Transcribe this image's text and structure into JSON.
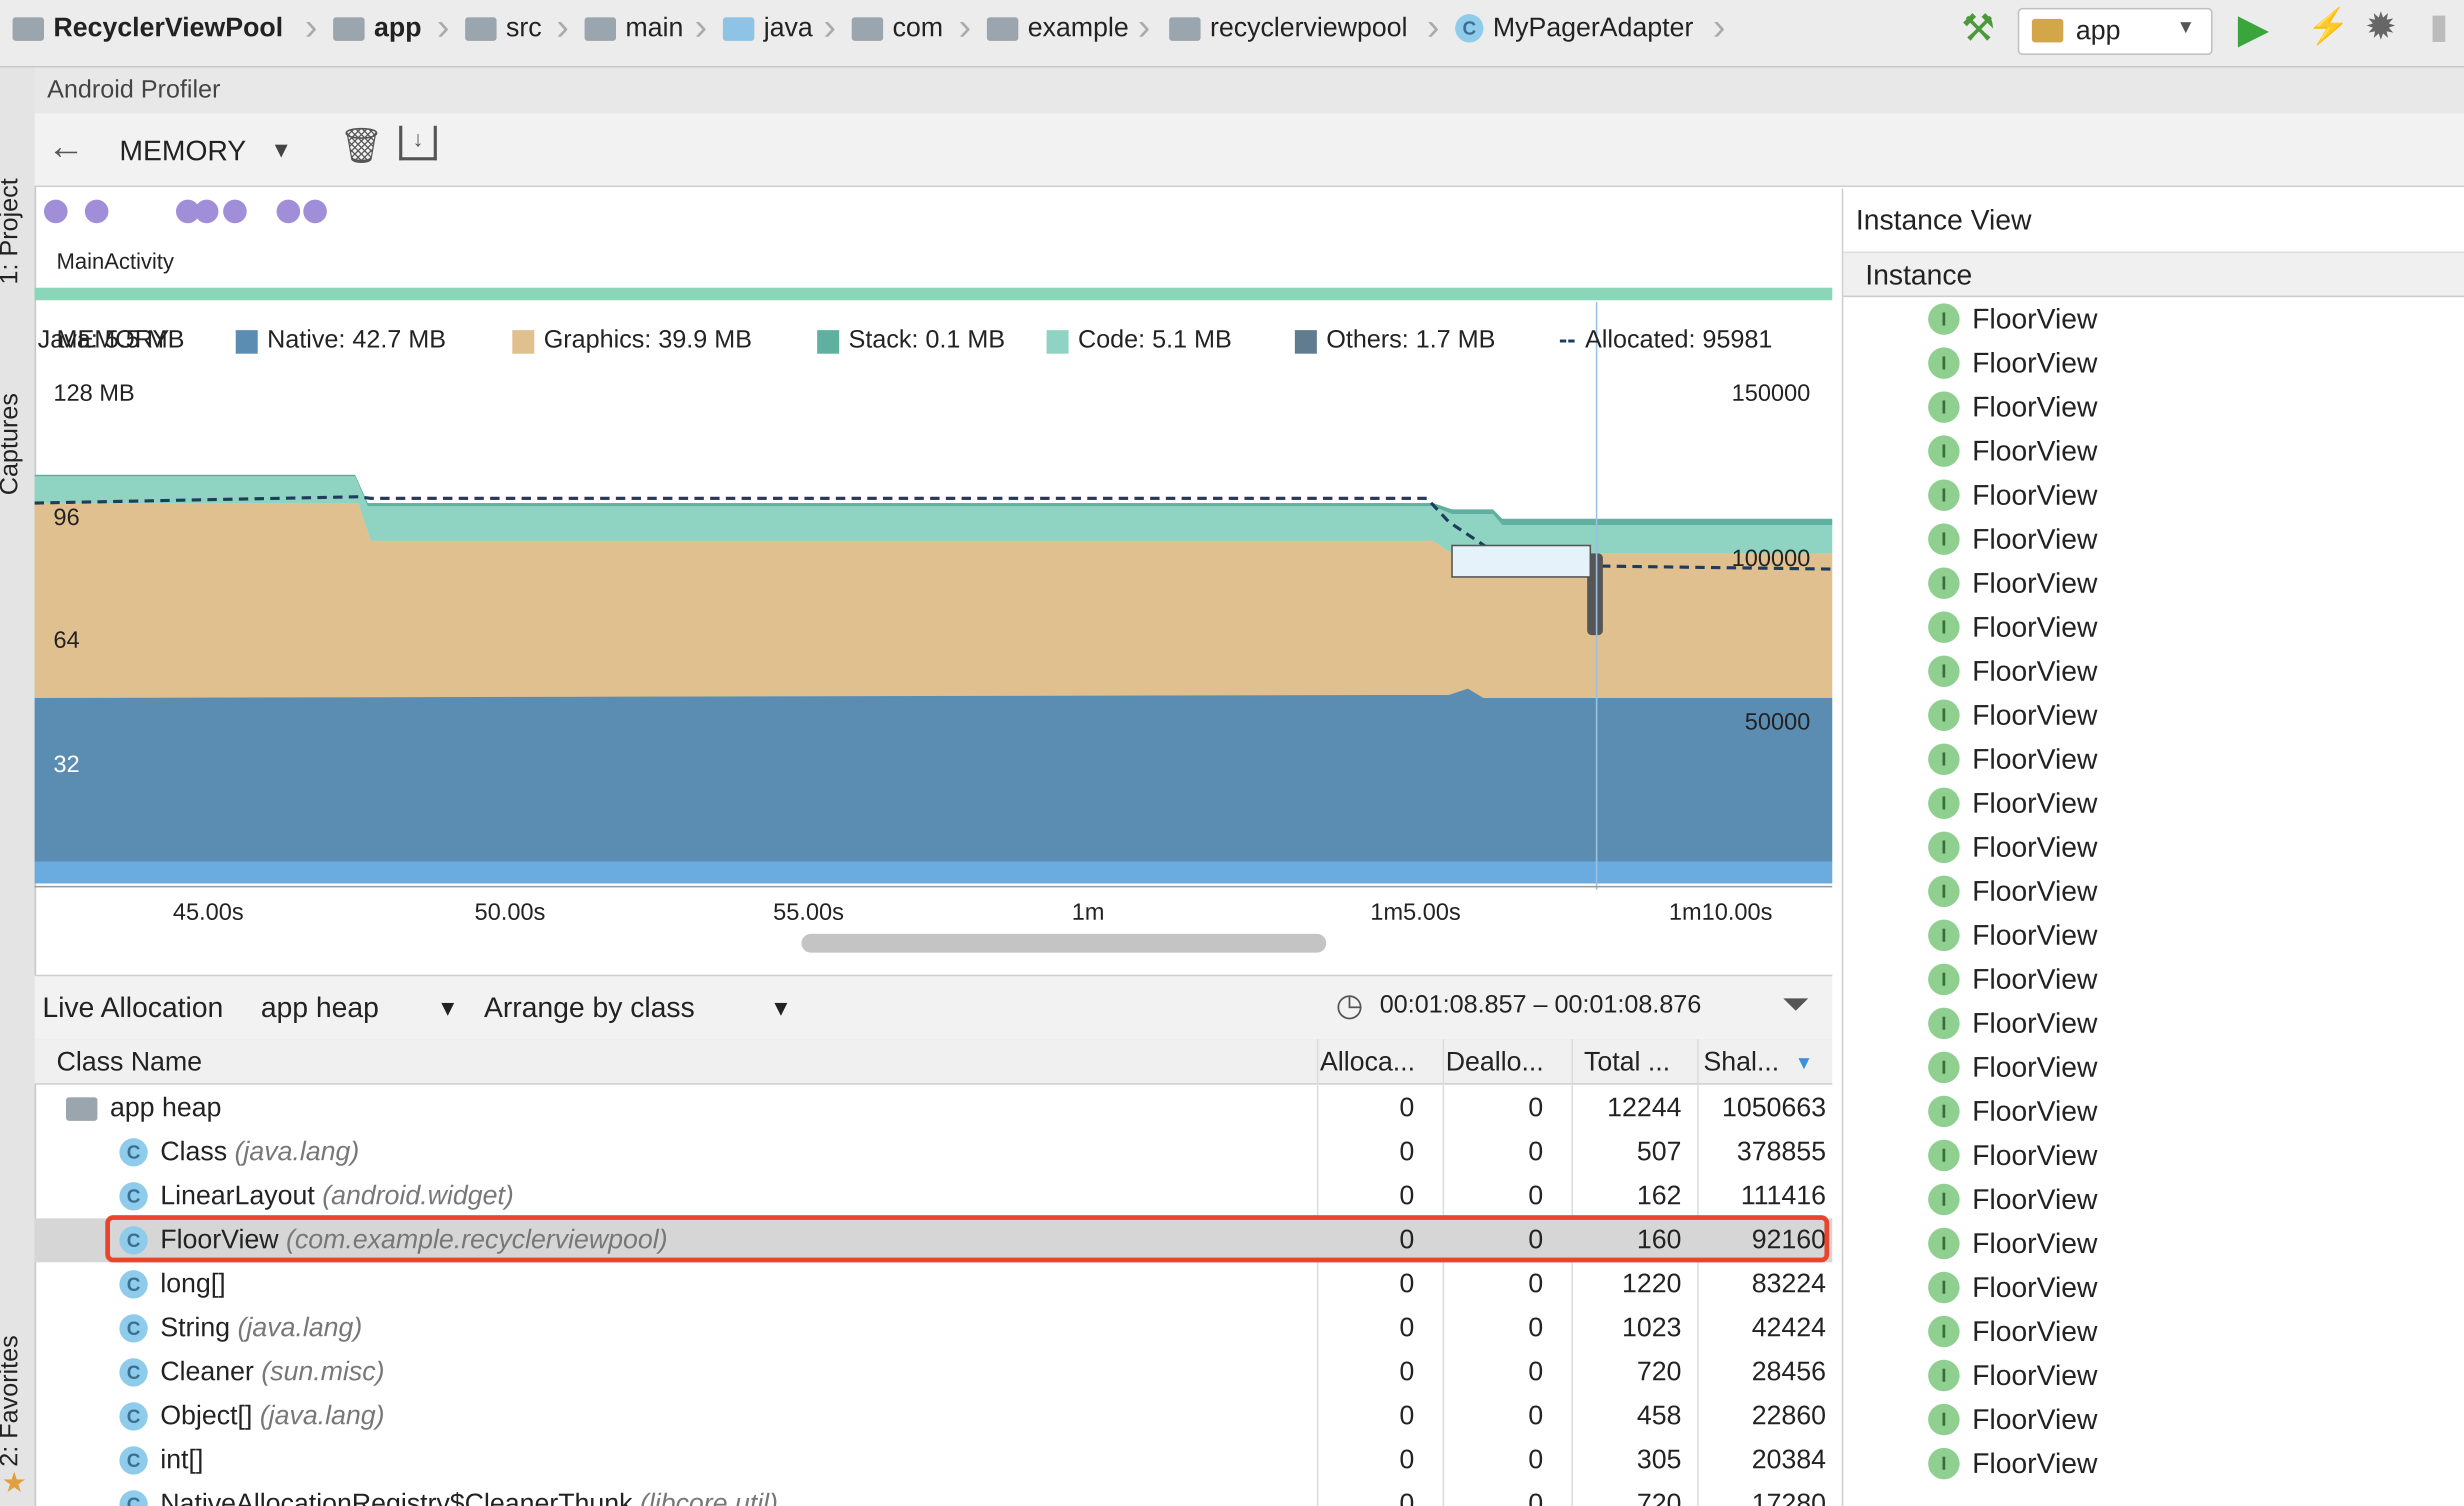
{
  "breadcrumbs": [
    "RecyclerViewPool",
    "app",
    "src",
    "main",
    "java",
    "com",
    "example",
    "recyclerviewpool",
    "MyPagerAdapter"
  ],
  "run_config": "app",
  "side_tabs": {
    "project": "1: Project",
    "captures": "Captures",
    "favorites": "2: Favorites"
  },
  "profiler_title": "Android Profiler",
  "toolbar": {
    "profiler_select": "MEMORY"
  },
  "events": {
    "activity_label": "MainActivity"
  },
  "memory_chart": {
    "overlay_label": "MEMORY",
    "legend": [
      {
        "label": "Java: 5.5 MB",
        "color": "#e8a35f"
      },
      {
        "label": "Native: 42.7 MB",
        "color": "#5b8db3"
      },
      {
        "label": "Graphics: 39.9 MB",
        "color": "#e0c08f"
      },
      {
        "label": "Stack: 0.1 MB",
        "color": "#5fb09e"
      },
      {
        "label": "Code: 5.1 MB",
        "color": "#8fd3c3"
      },
      {
        "label": "Others: 1.7 MB",
        "color": "#607c8e"
      },
      {
        "label": "Allocated: 95981",
        "color": "#1f3c5a"
      }
    ],
    "left_ticks": [
      "128 MB",
      "96",
      "64",
      "32"
    ],
    "right_ticks": [
      "150000",
      "100000",
      "50000"
    ],
    "time_ticks": [
      "45.00s",
      "50.00s",
      "55.00s",
      "1m",
      "1m5.00s",
      "1m10.00s"
    ]
  },
  "lower": {
    "mode": "Live Allocation",
    "heap": "app heap",
    "arrange": "Arrange by class",
    "range": "00:01:08.857 – 00:01:08.876",
    "columns": [
      "Class Name",
      "Alloca...",
      "Deallo...",
      "Total ...",
      "Shal..."
    ],
    "root": {
      "name": "app heap",
      "alloc": "0",
      "dealloc": "0",
      "total": "12244",
      "shallow": "1050663"
    },
    "rows": [
      {
        "name": "Class",
        "pkg": "(java.lang)",
        "alloc": "0",
        "dealloc": "0",
        "total": "507",
        "shallow": "378855"
      },
      {
        "name": "LinearLayout",
        "pkg": "(android.widget)",
        "alloc": "0",
        "dealloc": "0",
        "total": "162",
        "shallow": "111416"
      },
      {
        "name": "FloorView",
        "pkg": "(com.example.recyclerviewpool)",
        "alloc": "0",
        "dealloc": "0",
        "total": "160",
        "shallow": "92160"
      },
      {
        "name": "long[]",
        "pkg": "",
        "alloc": "0",
        "dealloc": "0",
        "total": "1220",
        "shallow": "83224"
      },
      {
        "name": "String",
        "pkg": "(java.lang)",
        "alloc": "0",
        "dealloc": "0",
        "total": "1023",
        "shallow": "42424"
      },
      {
        "name": "Cleaner",
        "pkg": "(sun.misc)",
        "alloc": "0",
        "dealloc": "0",
        "total": "720",
        "shallow": "28456"
      },
      {
        "name": "Object[]",
        "pkg": "(java.lang)",
        "alloc": "0",
        "dealloc": "0",
        "total": "458",
        "shallow": "22860"
      },
      {
        "name": "int[]",
        "pkg": "",
        "alloc": "0",
        "dealloc": "0",
        "total": "305",
        "shallow": "20384"
      },
      {
        "name": "NativeAllocationRegistry$CleanerThunk",
        "pkg": "(libcore.util)",
        "alloc": "0",
        "dealloc": "0",
        "total": "720",
        "shallow": "17280"
      }
    ],
    "highlight_color": "#e8452c"
  },
  "instance_view": {
    "title": "Instance View",
    "column": "Instance",
    "items": [
      "FloorView",
      "FloorView",
      "FloorView",
      "FloorView",
      "FloorView",
      "FloorView",
      "FloorView",
      "FloorView",
      "FloorView",
      "FloorView",
      "FloorView",
      "FloorView",
      "FloorView",
      "FloorView",
      "FloorView",
      "FloorView",
      "FloorView",
      "FloorView",
      "FloorView",
      "FloorView",
      "FloorView",
      "FloorView",
      "FloorView",
      "FloorView",
      "FloorView",
      "FloorView",
      "FloorView"
    ]
  }
}
